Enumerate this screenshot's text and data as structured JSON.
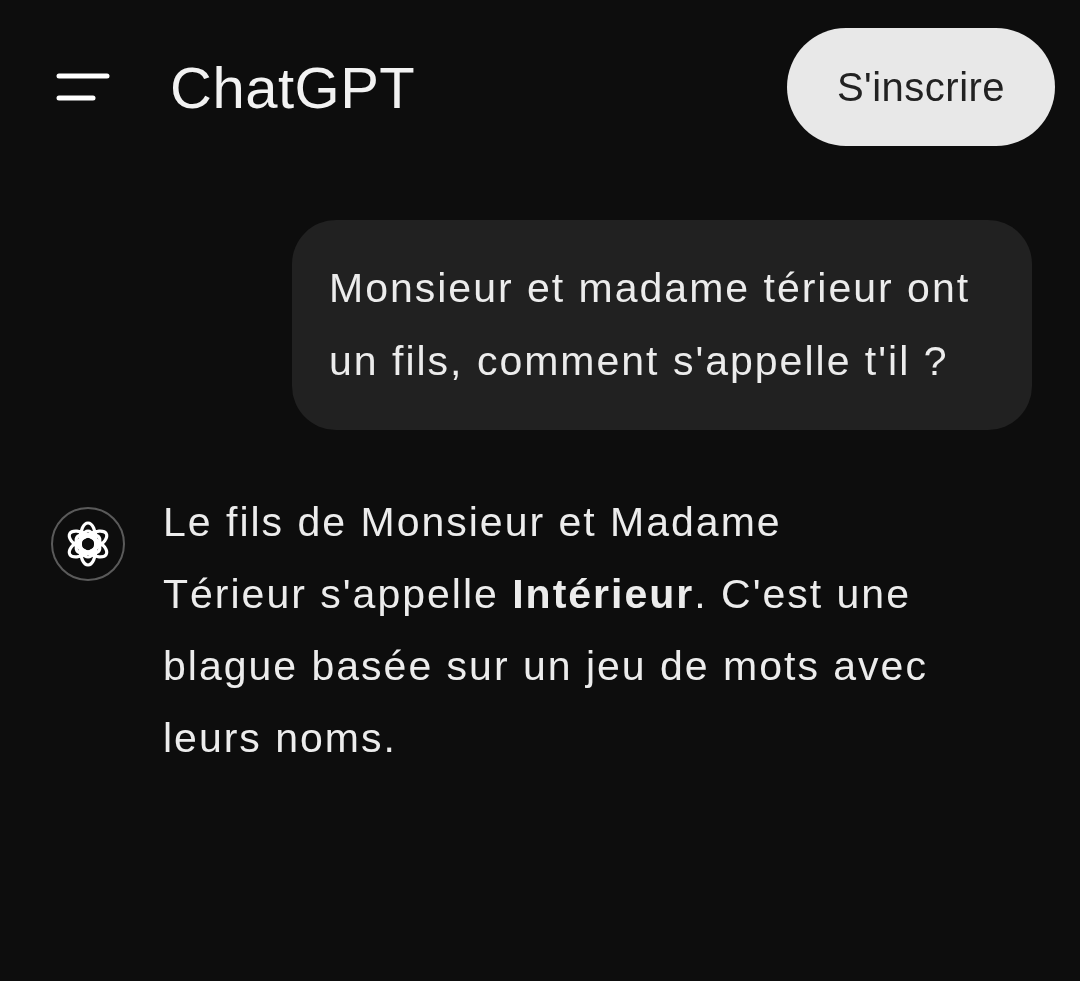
{
  "header": {
    "title": "ChatGPT",
    "signup_button": "S'inscrire"
  },
  "messages": [
    {
      "kind": "user",
      "text": "Monsieur et madame térieur ont un fils, comment s'appelle t'il ?"
    },
    {
      "kind": "assistant",
      "text": "Le fils de Monsieur et Madame Térieur s'appelle **Intérieur**. C'est une blague basée sur un jeu de mots avec leurs noms."
    }
  ]
}
